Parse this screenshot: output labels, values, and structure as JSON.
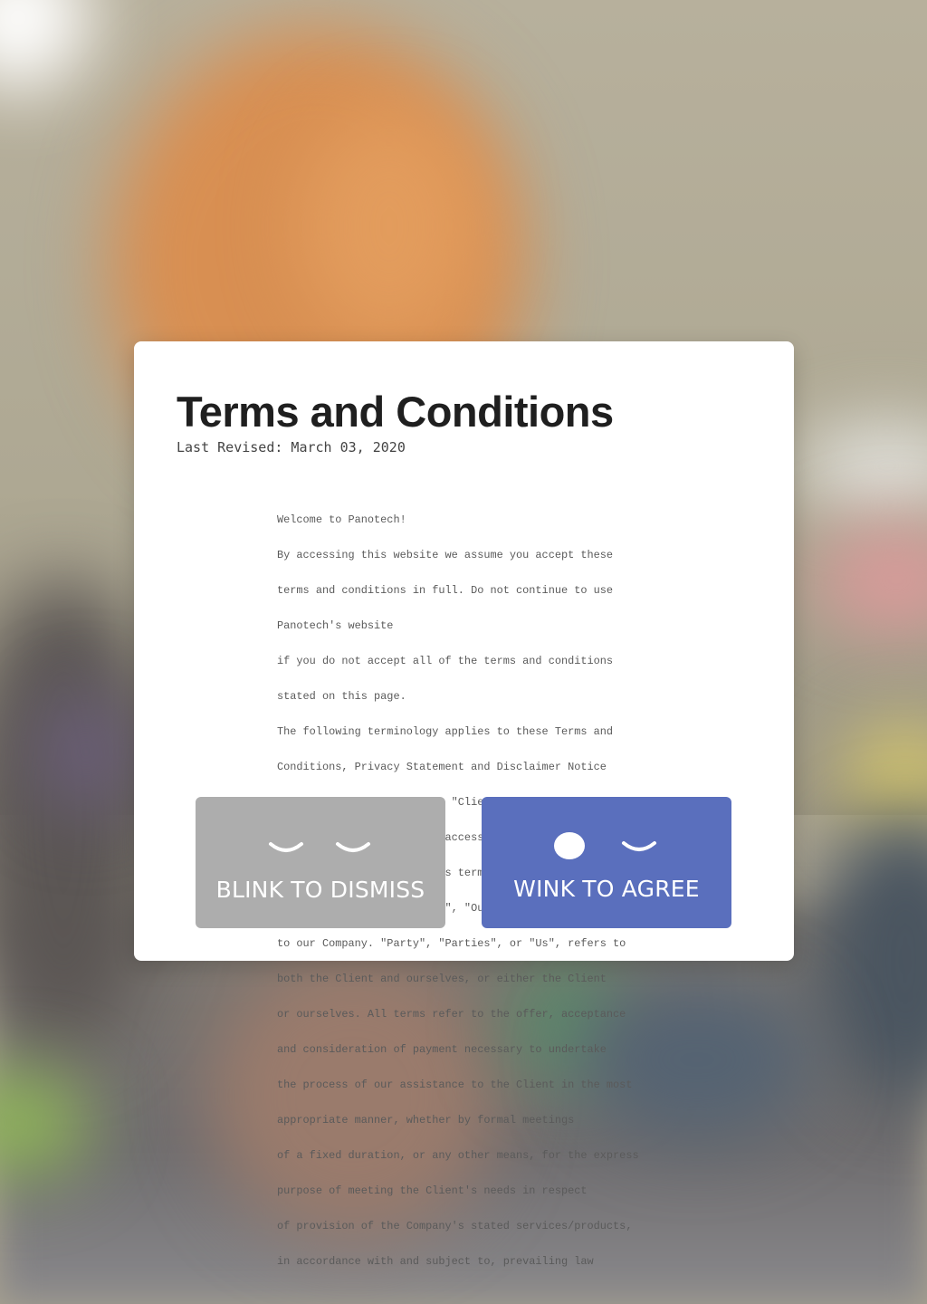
{
  "modal": {
    "title": "Terms and Conditions",
    "last_revised": "Last Revised: March 03, 2020",
    "terms_lines": [
      "Welcome to Panotech!",
      "By accessing this website we assume you accept these",
      "terms and conditions in full. Do not continue to use",
      "Panotech's website",
      "if you do not accept all of the terms and conditions",
      "stated on this page.",
      "The following terminology applies to these Terms and",
      "Conditions, Privacy Statement and Disclaimer Notice",
      "and any or all Agreements: \"Client\", \"You\" and \"Your\"",
      "refers to you, the person accessing this website",
      "and accepting the Company's terms and conditions. \"The",
      "Company\", \"Ourselves\", \"We\", \"Our\" and \"Us\", refers",
      "to our Company. \"Party\", \"Parties\", or \"Us\", refers to",
      "both the Client and ourselves, or either the Client",
      "or ourselves. All terms refer to the offer, acceptance",
      "and consideration of payment necessary to undertake",
      "the process of our assistance to the Client in the most",
      "appropriate manner, whether by formal meetings",
      "of a fixed duration, or any other means, for the express",
      "purpose of meeting the Client's needs in respect",
      "of provision of the Company's stated services/products,",
      "in accordance with and subject to, prevailing law"
    ]
  },
  "buttons": {
    "dismiss_label": "BLINK TO DISMISS",
    "agree_label": "WINK TO AGREE",
    "dismiss_icons": [
      "closed-eye-icon",
      "closed-eye-icon"
    ],
    "agree_icons": [
      "open-eye-icon",
      "closed-eye-icon"
    ]
  },
  "colors": {
    "dismiss_bg": "#adadad",
    "agree_bg": "#5a6fbd",
    "title_text": "#1f1f1f",
    "body_text": "#5a5a5a"
  }
}
